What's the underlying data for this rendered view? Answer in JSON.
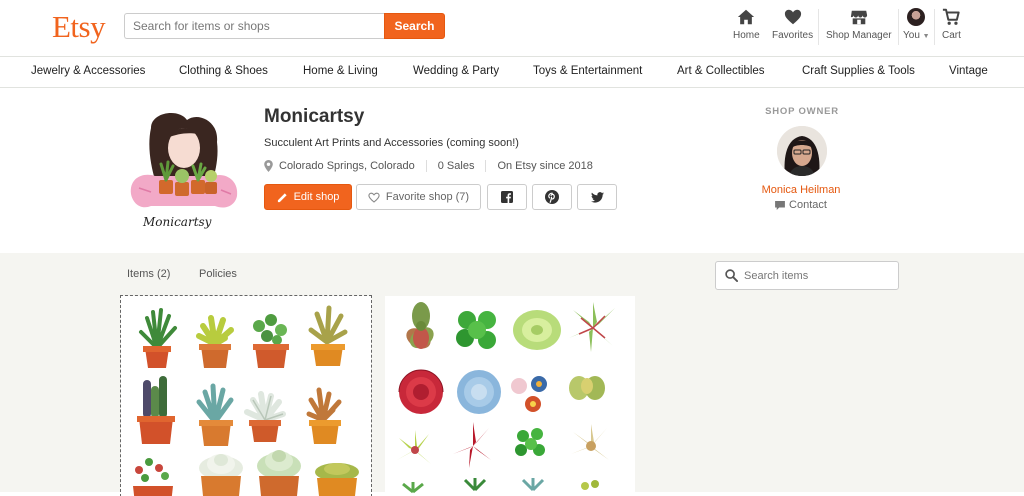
{
  "header": {
    "logo": "Etsy",
    "search_placeholder": "Search for items or shops",
    "search_button": "Search",
    "nav": {
      "home": "Home",
      "favorites": "Favorites",
      "shop_manager": "Shop Manager",
      "you": "You",
      "cart": "Cart"
    }
  },
  "categories": [
    "Jewelry & Accessories",
    "Clothing & Shoes",
    "Home & Living",
    "Wedding & Party",
    "Toys & Entertainment",
    "Art & Collectibles",
    "Craft Supplies & Tools",
    "Vintage"
  ],
  "shop": {
    "name": "Monicartsy",
    "tagline": "Succulent Art Prints and Accessories (coming soon!)",
    "location": "Colorado Springs, Colorado",
    "sales": "0 Sales",
    "since": "On Etsy since 2018",
    "edit_button": "Edit shop",
    "favorite_button": "Favorite shop (7)",
    "logo_signature": "Monicartsy"
  },
  "owner": {
    "label": "SHOP OWNER",
    "name": "Monica Heilman",
    "contact": "Contact"
  },
  "tabs": {
    "items": "Items (2)",
    "policies": "Policies"
  },
  "item_search_placeholder": "Search items",
  "colors": {
    "brand": "#f1641e",
    "background_lower": "#f5f5f1"
  },
  "icons": [
    "home-icon",
    "heart-icon",
    "shop-icon",
    "cart-icon",
    "pencil-icon",
    "location-pin-icon",
    "facebook-icon",
    "pinterest-icon",
    "twitter-icon",
    "search-icon",
    "chat-icon"
  ]
}
